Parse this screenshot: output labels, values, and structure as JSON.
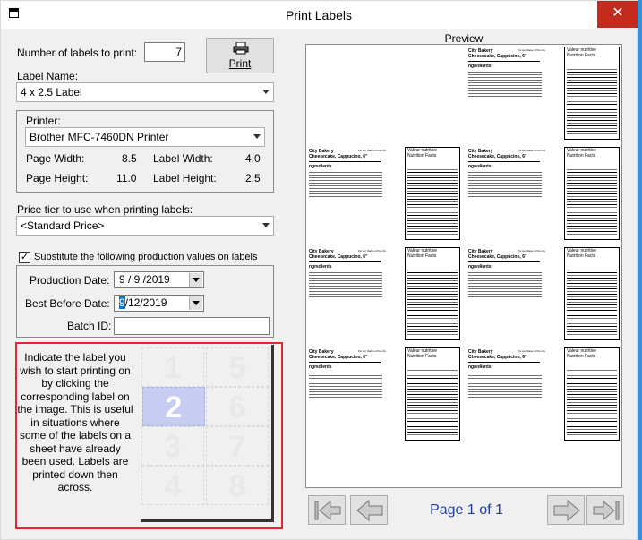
{
  "window": {
    "title": "Print Labels",
    "close_glyph": "✕"
  },
  "form": {
    "num_labels_label": "Number of labels to print:",
    "num_labels_value": "7",
    "print_button_label": "Print",
    "label_name_label": "Label Name:",
    "label_name_value": "4 x 2.5 Label",
    "printer_label": "Printer:",
    "printer_value": "Brother MFC-7460DN Printer",
    "page_width_label": "Page Width:",
    "page_width_value": "8.5",
    "label_width_label": "Label Width:",
    "label_width_value": "4.0",
    "page_height_label": "Page Height:",
    "page_height_value": "11.0",
    "label_height_label": "Label Height:",
    "label_height_value": "2.5",
    "price_tier_label": "Price tier to use when printing labels:",
    "price_tier_value": "<Standard Price>",
    "substitute_label": "Substitute the following production values on labels",
    "substitute_checked": "✓",
    "production_date_label": "Production Date:",
    "production_date_value": "9 / 9 /2019",
    "best_before_label": "Best Before Date:",
    "best_before_day": "9",
    "best_before_rest": "/12/2019",
    "batch_id_label": "Batch ID:",
    "batch_id_value": ""
  },
  "start_label": {
    "help_text": "Indicate the label you wish to start printing on by clicking the corresponding label on the image. This is useful in situations where some of the labels on a sheet have already been used. Labels are printed down then across.",
    "cells": [
      "1",
      "2",
      "3",
      "4",
      "5",
      "6",
      "7",
      "8"
    ],
    "selected": "2"
  },
  "preview": {
    "title": "Preview",
    "page_info": "Page 1 of 1",
    "label_company": "City Bakery",
    "label_product": "Cheesecake, Cappucino, 6\"",
    "label_ingredients": "ngredients",
    "label_side_note": "Fix sur (base of the city",
    "nutrition_title_fr": "Valeur nutritive",
    "nutrition_title_en": "Nutrition Facts"
  },
  "icons": {
    "printer": "printer-icon",
    "first_page": "first-page-icon",
    "prev_page": "prev-page-icon",
    "next_page": "next-page-icon",
    "last_page": "last-page-icon"
  }
}
